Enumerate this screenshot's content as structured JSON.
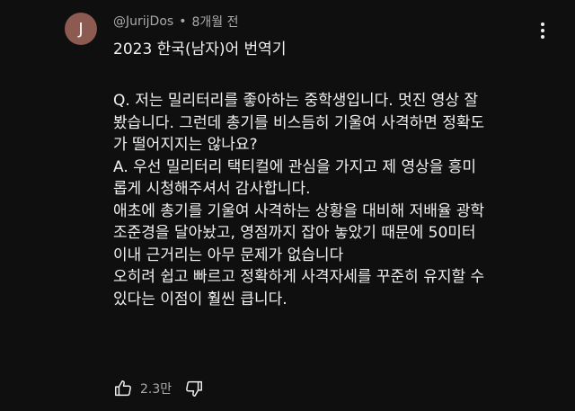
{
  "comment": {
    "avatar_letter": "J",
    "author": "@JurijDos",
    "separator": "•",
    "time_ago": "8개월 전",
    "title": "2023 한국(남자)어 번역기",
    "body_lines": [
      "Q. 저는 밀리터리를 좋아하는 중학생입니다. 멋진 영상 잘",
      "봤습니다. 그런데 총기를 비스듬히 기울여 사격하면 정확도",
      "가 떨어지지는 않나요?",
      "A. 우선 밀리터리 택티컬에 관심을 가지고 제 영상을 흥미",
      "롭게 시청해주셔서 감사합니다.",
      "애초에 총기를 기울여 사격하는 상황을 대비해 저배율 광학",
      "조준경을 달아놨고, 영점까지 잡아 놓았기 때문에 50미터",
      "이내 근거리는 아무 문제가 없습니다",
      "오히려 쉽고 빠르고 정확하게 사격자세를 꾸준히 유지할 수",
      "있다는 이점이 훨씬 큽니다."
    ],
    "like_count": "2.3만",
    "icons": {
      "menu": "more-vertical-icon",
      "like": "thumbs-up-icon",
      "dislike": "thumbs-down-icon"
    }
  },
  "colors": {
    "background": "#0f0f0f",
    "text": "#f1f1f1",
    "secondary_text": "#aaaaaa",
    "avatar_bg": "#8d5a52"
  }
}
